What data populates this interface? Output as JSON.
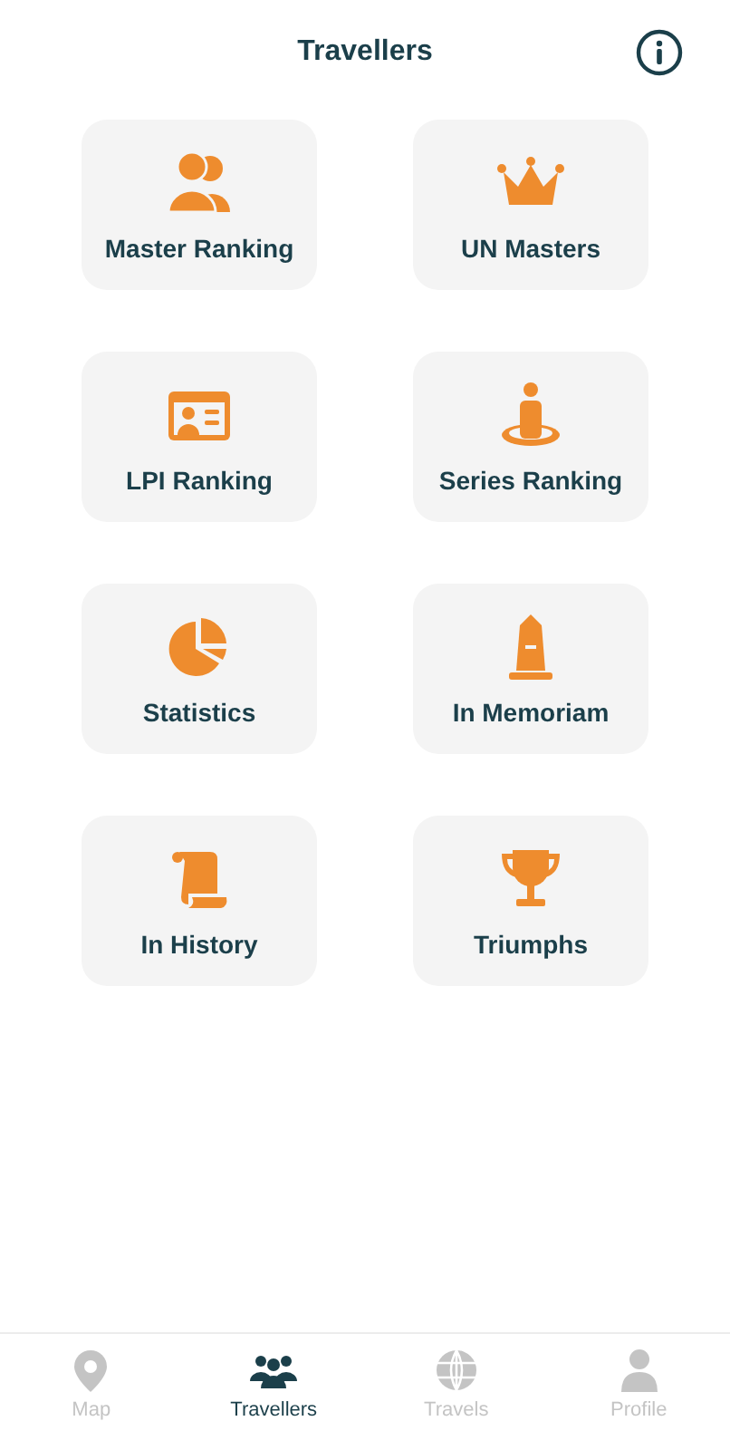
{
  "header": {
    "title": "Travellers"
  },
  "cards": [
    {
      "label": "Master Ranking",
      "kind": "people"
    },
    {
      "label": "UN Masters",
      "kind": "crown"
    },
    {
      "label": "LPI Ranking",
      "kind": "idcard"
    },
    {
      "label": "Series Ranking",
      "kind": "person-ring"
    },
    {
      "label": "Statistics",
      "kind": "pie"
    },
    {
      "label": "In Memoriam",
      "kind": "monument"
    },
    {
      "label": "In History",
      "kind": "scroll"
    },
    {
      "label": "Triumphs",
      "kind": "trophy"
    }
  ],
  "tab_bar": [
    {
      "label": "Map",
      "kind": "pin",
      "selected": false
    },
    {
      "label": "Travellers",
      "kind": "people",
      "selected": true
    },
    {
      "label": "Travels",
      "kind": "globe",
      "selected": false
    },
    {
      "label": "Profile",
      "kind": "person",
      "selected": false
    }
  ]
}
